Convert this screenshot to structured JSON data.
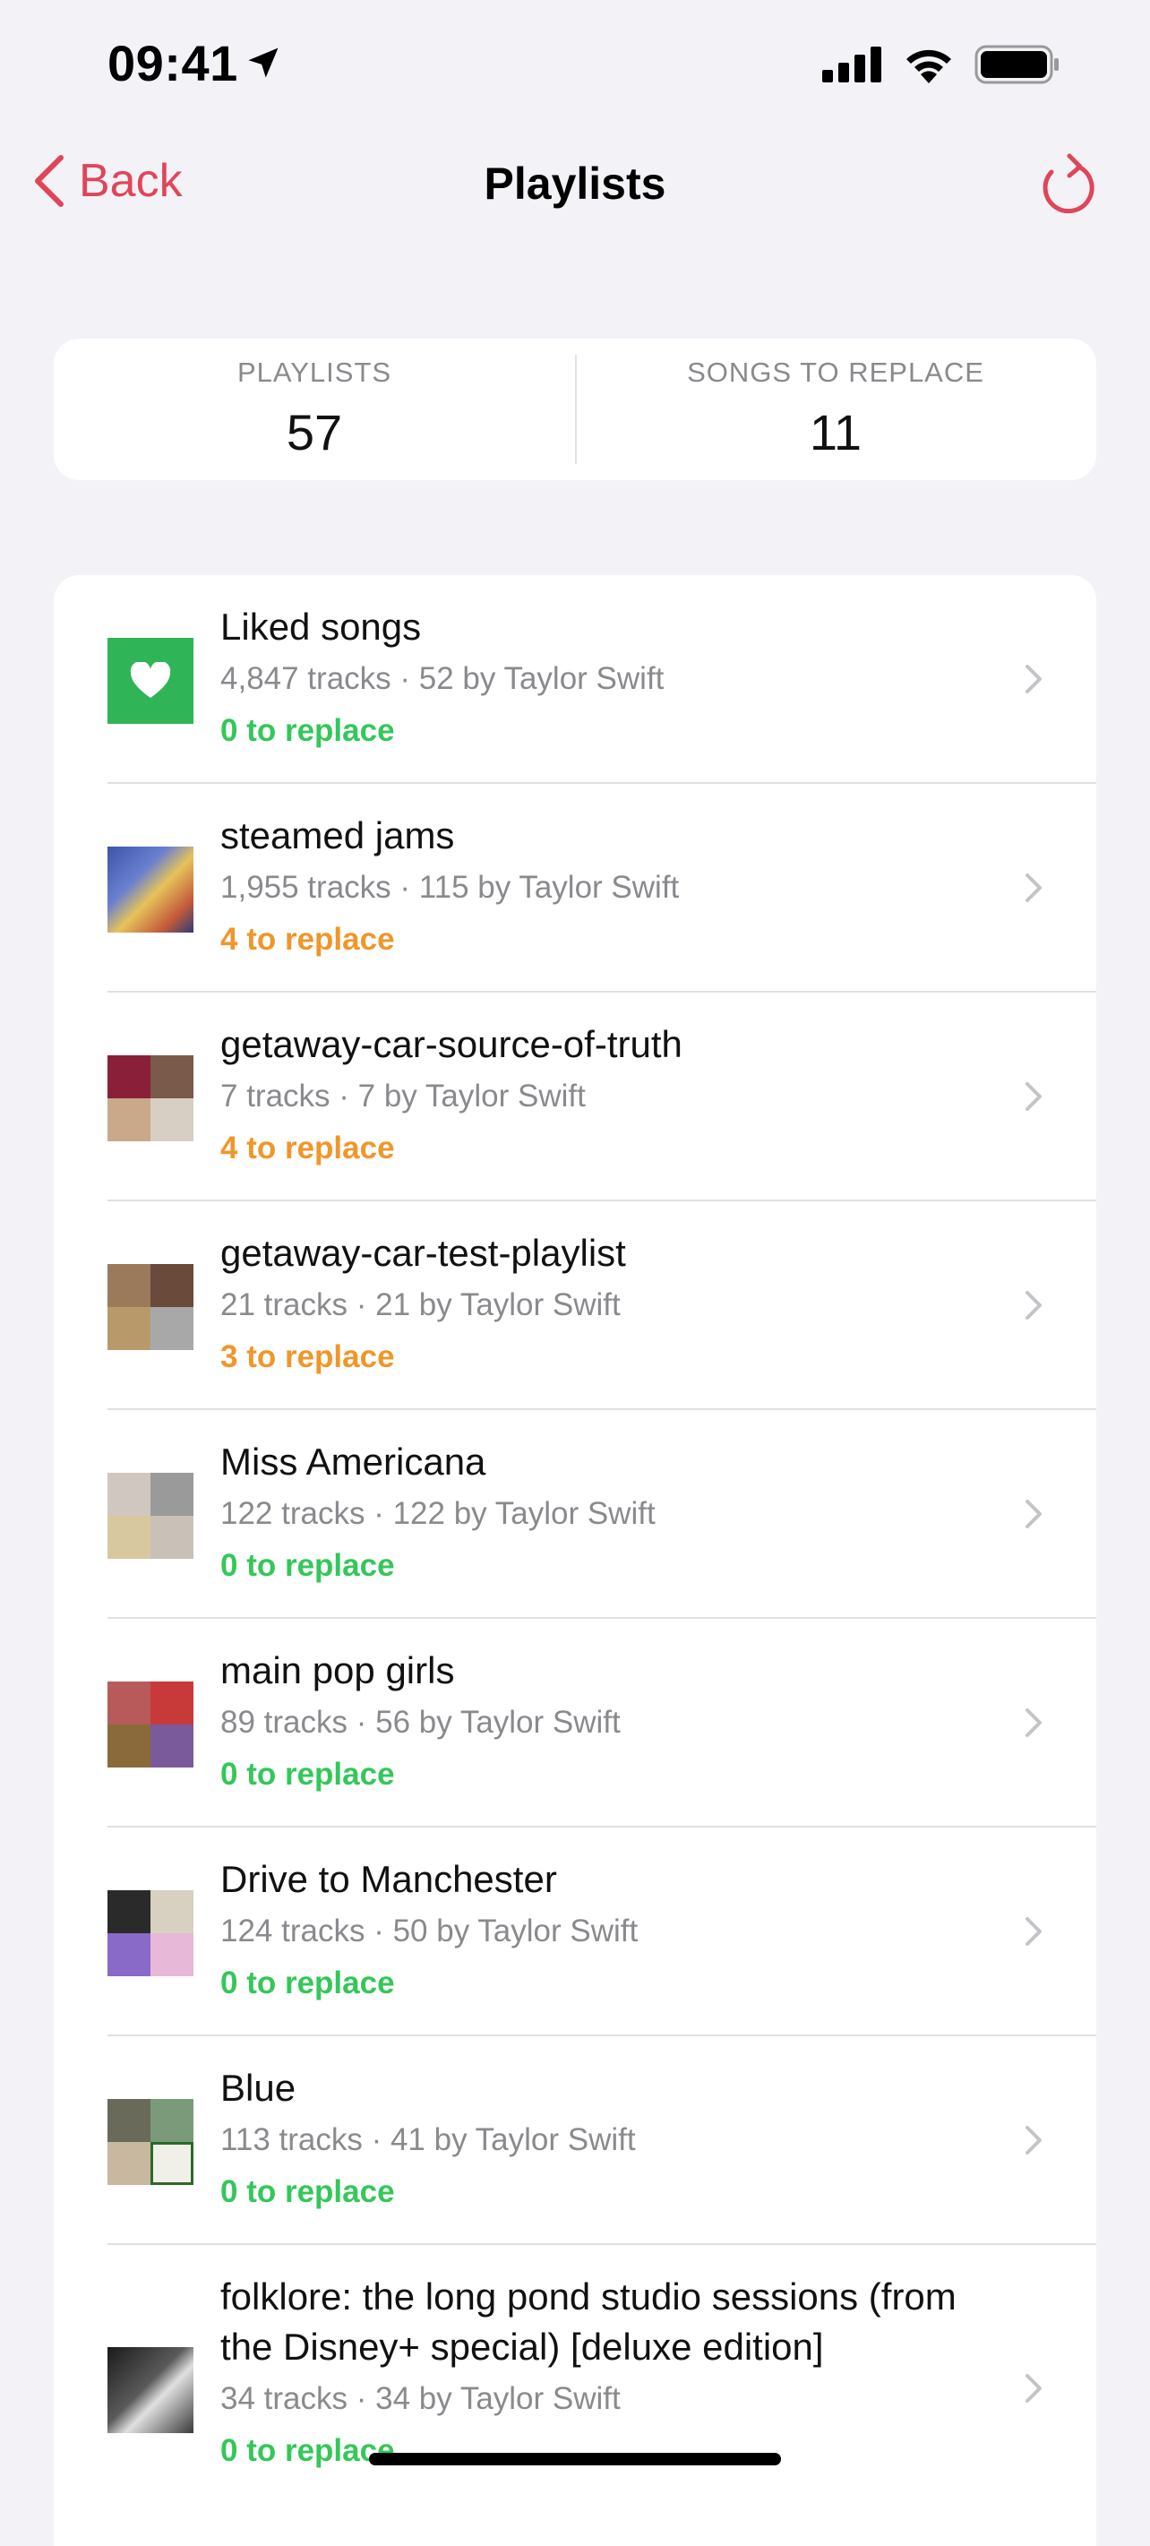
{
  "status_bar": {
    "time": "09:41"
  },
  "nav": {
    "back_label": "Back",
    "title": "Playlists"
  },
  "stats": {
    "playlists_label": "PLAYLISTS",
    "playlists_value": "57",
    "songs_label": "SONGS TO REPLACE",
    "songs_value": "11"
  },
  "playlists": [
    {
      "name": "Liked songs",
      "meta": "4,847 tracks · 52 by Taylor Swift",
      "replace": "0 to replace",
      "status": "ok",
      "art": "heart"
    },
    {
      "name": "steamed jams",
      "meta": "1,955 tracks · 115 by Taylor Swift",
      "replace": "4 to replace",
      "status": "warn",
      "art": "single"
    },
    {
      "name": "getaway-car-source-of-truth",
      "meta": "7 tracks · 7 by Taylor Swift",
      "replace": "4 to replace",
      "status": "warn",
      "art": "grid"
    },
    {
      "name": "getaway-car-test-playlist",
      "meta": "21 tracks · 21 by Taylor Swift",
      "replace": "3 to replace",
      "status": "warn",
      "art": "grid"
    },
    {
      "name": "Miss Americana",
      "meta": "122 tracks · 122 by Taylor Swift",
      "replace": "0 to replace",
      "status": "ok",
      "art": "grid"
    },
    {
      "name": "main pop girls",
      "meta": "89 tracks · 56 by Taylor Swift",
      "replace": "0 to replace",
      "status": "ok",
      "art": "grid"
    },
    {
      "name": "Drive to Manchester",
      "meta": "124 tracks · 50 by Taylor Swift",
      "replace": "0 to replace",
      "status": "ok",
      "art": "grid"
    },
    {
      "name": "Blue",
      "meta": "113 tracks · 41 by Taylor Swift",
      "replace": "0 to replace",
      "status": "ok",
      "art": "grid"
    },
    {
      "name": "folklore: the long pond studio sessions (from the Disney+ special) [deluxe edition]",
      "meta": "34 tracks · 34 by Taylor Swift",
      "replace": "0 to replace",
      "status": "ok",
      "art": "single-dark"
    }
  ],
  "colors": {
    "accent": "#e0455a",
    "ok": "#34c759",
    "warn": "#f0962a",
    "liked_bg": "#2fb457"
  },
  "icons": {
    "back": "chevron-left-icon",
    "refresh": "refresh-icon",
    "row": "chevron-right-icon",
    "location": "location-arrow-icon"
  }
}
